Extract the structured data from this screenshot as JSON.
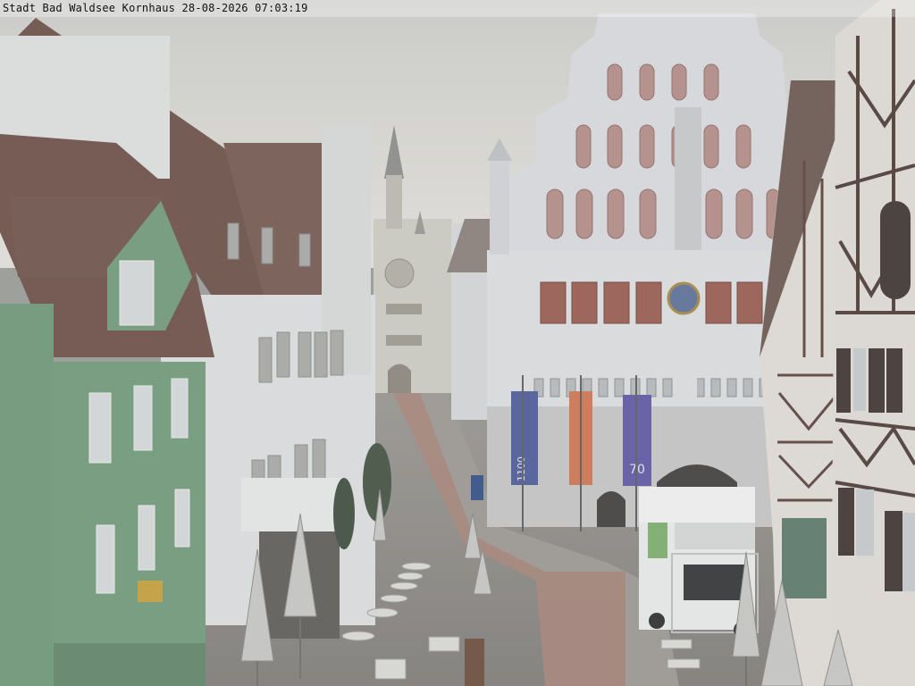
{
  "overlay": {
    "caption": "Stadt Bad Waldsee Kornhaus 28-08-2026 07:03:19"
  },
  "scene": {
    "banners": [
      "1100",
      "",
      "70"
    ],
    "colors": {
      "sky": "#d9dad6",
      "green_facade": "#6f9a78",
      "white_facade": "#dfe1e2",
      "roof": "#6b4f46",
      "banner_blue": "#4a5a9a",
      "banner_orange": "#d2744e",
      "banner_purple": "#5e56a6",
      "pavement": "#8f8c88",
      "road": "#a98478"
    }
  }
}
